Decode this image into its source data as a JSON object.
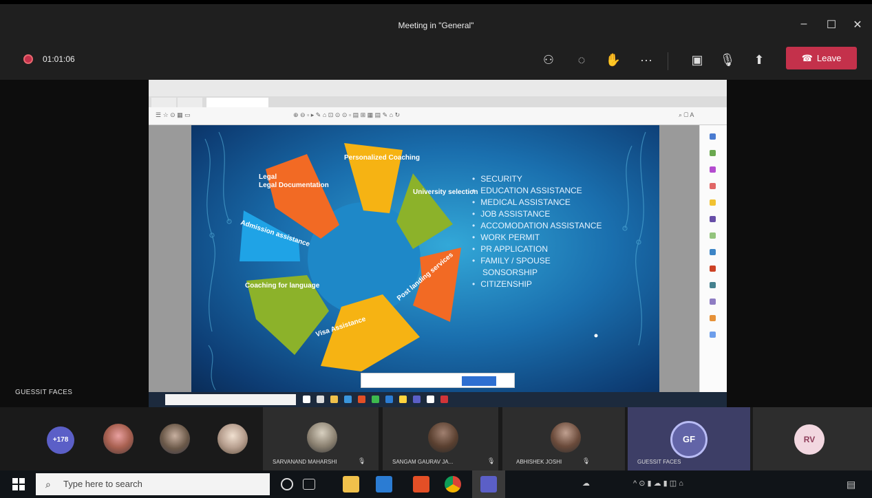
{
  "window": {
    "title": "Meeting in \"General\""
  },
  "toolbar": {
    "timer": "01:01:06",
    "leave_label": "Leave"
  },
  "stage": {
    "presenter_label": "GUESSIT FACES"
  },
  "slide": {
    "wheel_segments": [
      "Legal Documentation",
      "Personalized Coaching",
      "University selection",
      "Post landing services",
      "Visa Assistance",
      "Coaching for language",
      "Admission assistance"
    ],
    "bullets": [
      "SECURITY",
      "EDUCATION ASSISTANCE",
      "MEDICAL ASSISTANCE",
      "JOB ASSISTANCE",
      "ACCOMODATION ASSISTANCE",
      "WORK PERMIT",
      "PR APPLICATION",
      "FAMILY / SPOUSE",
      "SONSORSHIP",
      "CITIZENSHIP"
    ]
  },
  "participants": {
    "overflow_count": "+178",
    "tiles": [
      {
        "name": "SARVANAND MAHARSHI"
      },
      {
        "name": "SANGAM GAURAV JA..."
      },
      {
        "name": "ABHISHEK JOSHI"
      },
      {
        "name": "GUESSIT FACES",
        "initials": "GF"
      },
      {
        "initials": "RV"
      }
    ]
  },
  "taskbar": {
    "search_placeholder": "Type here to search"
  },
  "colors": {
    "leave": "#c4314b",
    "accent": "#6264a7"
  }
}
